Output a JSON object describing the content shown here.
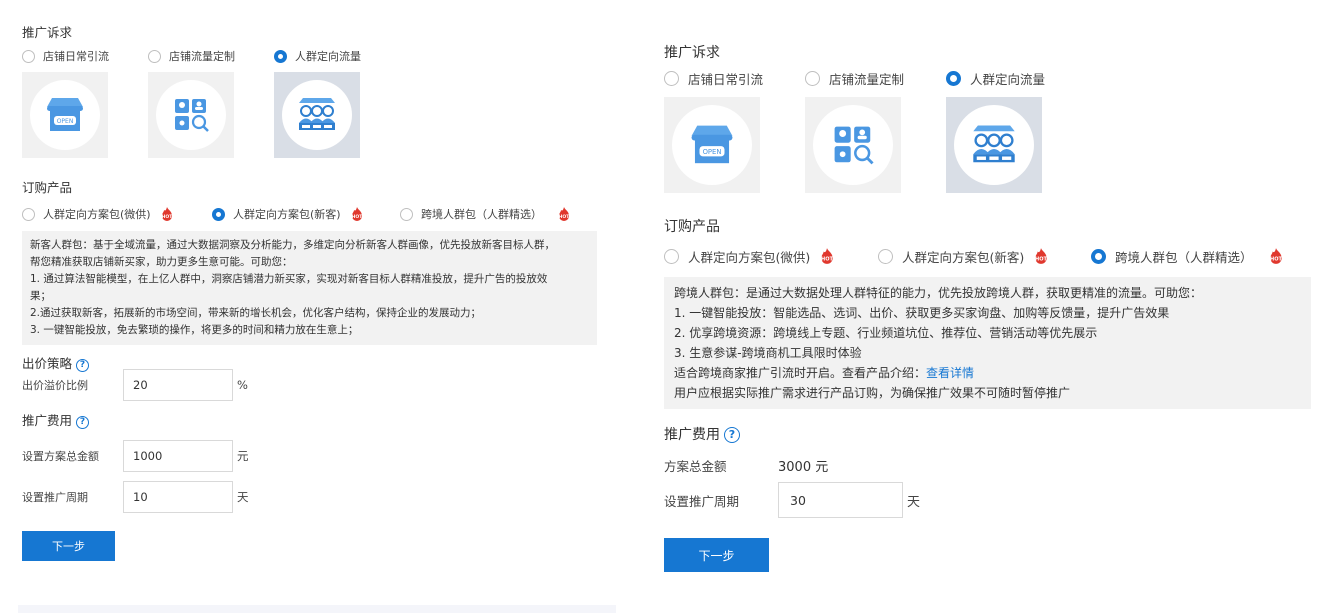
{
  "colors": {
    "primary": "#1677d2",
    "hot": "#e0382e",
    "desc_bg": "#f2f2f2"
  },
  "left": {
    "promo_title": "推广诉求",
    "promo_options": [
      {
        "label": "店铺日常引流",
        "checked": false,
        "icon": "storefront-icon"
      },
      {
        "label": "店铺流量定制",
        "checked": false,
        "icon": "traffic-custom-icon"
      },
      {
        "label": "人群定向流量",
        "checked": true,
        "icon": "crowd-target-icon"
      }
    ],
    "product_title": "订购产品",
    "product_options": [
      {
        "label": "人群定向方案包(微供)",
        "checked": false,
        "badge": "HOT"
      },
      {
        "label": "人群定向方案包(新客)",
        "checked": true,
        "badge": "HOT"
      },
      {
        "label": "跨境人群包（人群精选）",
        "checked": false,
        "badge": "HOT"
      }
    ],
    "desc_lines": [
      "新客人群包：基于全域流量，通过大数据洞察及分析能力，多维定向分析新客人群画像，优先投放新客目标人群，",
      "帮您精准获取店铺新买家，助力更多生意可能。可助您：",
      "1. 通过算法智能模型，在上亿人群中，洞察店铺潜力新买家，实现对新客目标人群精准投放，提升广告的投放效",
      "果；",
      "2.通过获取新客，拓展新的市场空间，带来新的增长机会，优化客户结构，保持企业的发展动力；",
      "3. 一键智能投放，免去繁琐的操作，将更多的时间和精力放在生意上；"
    ],
    "bid_title": "出价策略",
    "bid_label": "出价溢价比例",
    "bid_value": "20",
    "bid_unit": "%",
    "fee_title": "推广费用",
    "total_label": "设置方案总金额",
    "total_value": "1000",
    "total_unit": "元",
    "period_label": "设置推广周期",
    "period_value": "10",
    "period_unit": "天",
    "next_label": "下一步"
  },
  "right": {
    "promo_title": "推广诉求",
    "promo_options": [
      {
        "label": "店铺日常引流",
        "checked": false,
        "icon": "storefront-icon"
      },
      {
        "label": "店铺流量定制",
        "checked": false,
        "icon": "traffic-custom-icon"
      },
      {
        "label": "人群定向流量",
        "checked": true,
        "icon": "crowd-target-icon"
      }
    ],
    "product_title": "订购产品",
    "product_options": [
      {
        "label": "人群定向方案包(微供)",
        "checked": false,
        "badge": "HOT"
      },
      {
        "label": "人群定向方案包(新客)",
        "checked": false,
        "badge": "HOT"
      },
      {
        "label": "跨境人群包（人群精选）",
        "checked": true,
        "badge": "HOT"
      }
    ],
    "desc_lines": [
      "跨境人群包：是通过大数据处理人群特征的能力，优先投放跨境人群，获取更精准的流量。可助您：",
      "1. 一键智能投放：智能选品、选词、出价、获取更多买家询盘、加购等反馈量，提升广告效果",
      "2. 优享跨境资源：跨境线上专题、行业频道坑位、推荐位、营销活动等优先展示",
      "3. 生意参谋-跨境商机工具限时体验"
    ],
    "desc_intro_line": "适合跨境商家推广引流时开启。查看产品介绍：",
    "desc_link": "查看详情",
    "desc_last_line": "用户应根据实际推广需求进行产品订购，为确保推广效果不可随时暂停推广",
    "fee_title": "推广费用",
    "total_label": "方案总金额",
    "total_value": "3000 元",
    "period_label": "设置推广周期",
    "period_value": "30",
    "period_unit": "天",
    "next_label": "下一步"
  }
}
